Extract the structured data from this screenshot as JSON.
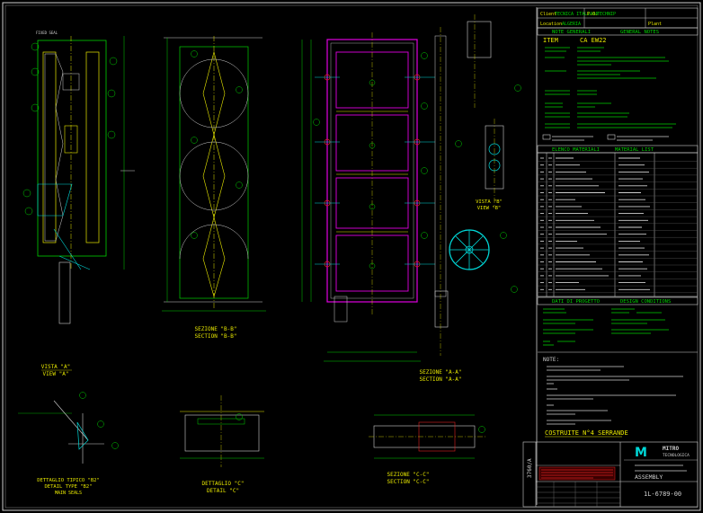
{
  "title_block": {
    "client_label": "Client",
    "client_value": "TECNICA ITALIANA",
    "po_label": "P.O.",
    "po_value": "TECHNIP",
    "location_label": "Location",
    "location_value": "ALGERIA",
    "plant_label": "Plant"
  },
  "notes": {
    "heading_it": "NOTE GENERALI",
    "heading_en": "GENERAL NOTES",
    "item_label": "ITEM",
    "item_value": "CA EW22"
  },
  "materials": {
    "heading_it": "ELENCO MATERIALI",
    "heading_en": "MATERIAL LIST"
  },
  "design": {
    "heading_it": "DATI DI PROGETTO",
    "heading_en": "DESIGN CONDITIONS"
  },
  "notes2": {
    "heading": "NOTE:"
  },
  "build": {
    "text": "COSTRUITE N°4 SERRANDE"
  },
  "company": {
    "logo_letter": "M",
    "name": "MITRO",
    "sub": "TECNOLOGICA",
    "title": "ASSEMBLY",
    "drawing_no": "1L-6789-00",
    "side_code": "3760/A"
  },
  "views": {
    "section_aa_it": "SEZIONE \"A-A\"",
    "section_aa_en": "SECTION \"A-A\"",
    "section_bb_it": "SEZIONE \"B-B\"",
    "section_bb_en": "SECTION \"B-B\"",
    "view_a_it": "VISTA \"A\"",
    "view_a_en": "VIEW \"A\"",
    "view_b_it": "VISTA \"B\"",
    "view_b_en": "VIEW \"B\"",
    "detail_b2_it": "DETTAGLIO TIPICO \"B2\"",
    "detail_b2_en": "DETAIL TYPE \"B2\"",
    "detail_b2_sub": "MAIN SEALS",
    "detail_c_it": "DETTAGLIO \"C\"",
    "detail_c_en": "DETAIL \"C\"",
    "section_cc_it": "SEZIONE \"C-C\"",
    "section_cc_en": "SECTION \"C-C\""
  },
  "colors": {
    "background": "#000000",
    "frame": "#d8d8d8",
    "green": "#00d000",
    "yellow": "#e8e800",
    "cyan": "#00d8d8",
    "magenta": "#e000e0",
    "red": "#e02020",
    "white": "#ffffff"
  }
}
